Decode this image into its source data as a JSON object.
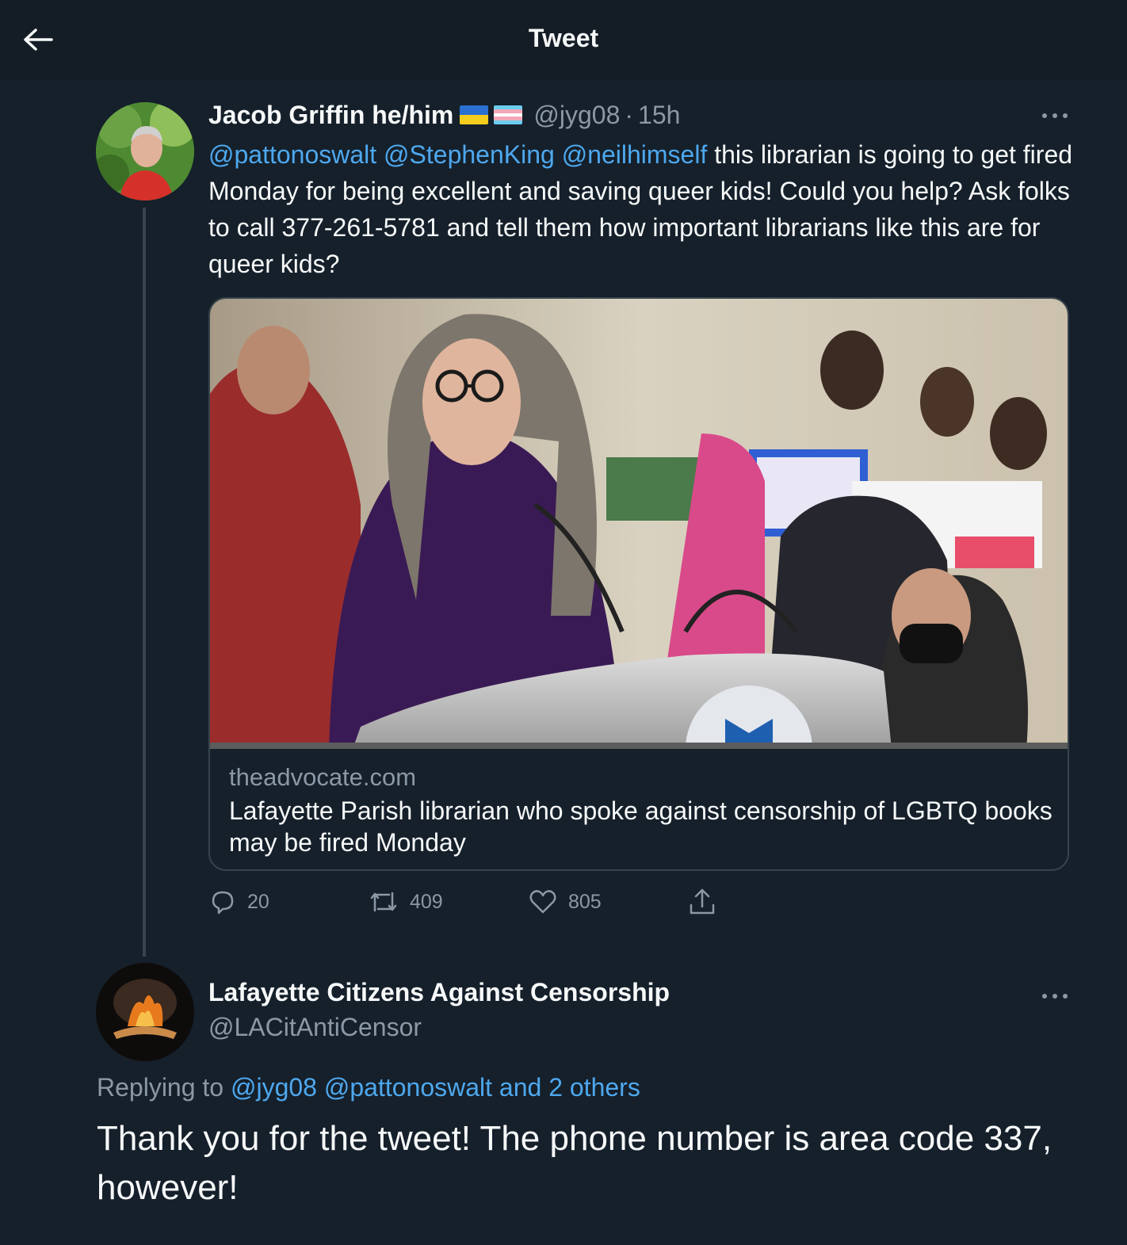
{
  "header": {
    "title": "Tweet",
    "back_icon": "arrow-left-icon"
  },
  "tweet": {
    "author": {
      "display_name": "Jacob Griffin he/him",
      "flags": [
        "ukraine-flag",
        "transgender-flag"
      ],
      "handle": "@jyg08",
      "separator": "·",
      "time": "15h"
    },
    "mentions": [
      "@pattonoswalt",
      "@StephenKing",
      "@neilhimself"
    ],
    "body": "this librarian is going to get fired Monday for being excellent and saving queer kids! Could you help? Ask folks to call 377-261-5781 and tell them how important librarians like this are for queer kids?",
    "card": {
      "domain": "theadvocate.com",
      "title": "Lafayette Parish librarian who spoke against censorship of LGBTQ books may be fired Monday"
    },
    "actions": {
      "reply": {
        "icon": "reply-icon",
        "count": "20"
      },
      "retweet": {
        "icon": "retweet-icon",
        "count": "409"
      },
      "like": {
        "icon": "heart-icon",
        "count": "805"
      },
      "share": {
        "icon": "share-icon"
      }
    }
  },
  "reply": {
    "author": {
      "display_name": "Lafayette Citizens Against Censorship",
      "handle": "@LACitAntiCensor"
    },
    "replying_prefix": "Replying to",
    "replying_to": "@jyg08 @pattonoswalt and 2 others",
    "body": "Thank you for the tweet! The phone number is area code 337, however!"
  },
  "colors": {
    "background": "#15202b",
    "header": "#141d26",
    "link": "#4ea8ee",
    "muted": "#8b98a5",
    "text": "#f7f9f9",
    "border": "#38444d"
  }
}
